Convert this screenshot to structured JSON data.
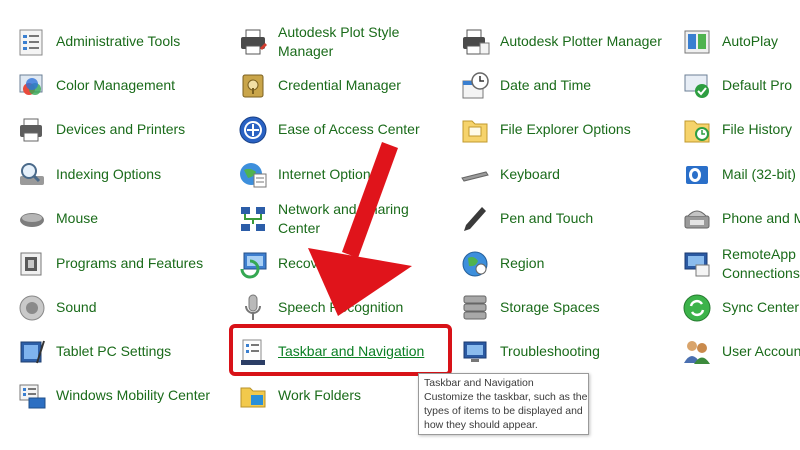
{
  "items": {
    "administrative_tools": "Administrative Tools",
    "autodesk_plot_style_manager": "Autodesk Plot Style Manager",
    "autodesk_plotter_manager": "Autodesk Plotter Manager",
    "autoplay": "AutoPlay",
    "color_management": "Color Management",
    "credential_manager": "Credential Manager",
    "date_and_time": "Date and Time",
    "default_programs": "Default Pro",
    "devices_and_printers": "Devices and Printers",
    "ease_of_access_center": "Ease of Access Center",
    "file_explorer_options": "File Explorer Options",
    "file_history": "File History",
    "indexing_options": "Indexing Options",
    "internet_options": "Internet Option",
    "keyboard": "Keyboard",
    "mail": "Mail (32-bit)",
    "mouse": "Mouse",
    "network_and_sharing_center": "Network and Sharing Center",
    "pen_and_touch": "Pen and Touch",
    "phone_and_modem": "Phone and M",
    "programs_and_features": "Programs and Features",
    "recovery": "Recovery",
    "region": "Region",
    "remoteapp": "RemoteApp Connections",
    "sound": "Sound",
    "speech_recognition": "Speech Recognition",
    "storage_spaces": "Storage Spaces",
    "sync_center": "Sync Center",
    "tablet_pc_settings": "Tablet PC Settings",
    "taskbar_and_navigation": "Taskbar and Navigation",
    "troubleshooting": "Troubleshooting",
    "user_accounts": "User Accoun",
    "windows_mobility_center": "Windows Mobility Center",
    "work_folders": "Work Folders"
  },
  "tooltip": {
    "title": "Taskbar and Navigation",
    "line1": "Customize the taskbar, such as the",
    "line2": "types of items to be displayed and",
    "line3": "how they should appear."
  },
  "colors": {
    "link_green": "#1a6b1a",
    "highlight_red": "#d81218",
    "arrow_red": "#e0141b"
  }
}
